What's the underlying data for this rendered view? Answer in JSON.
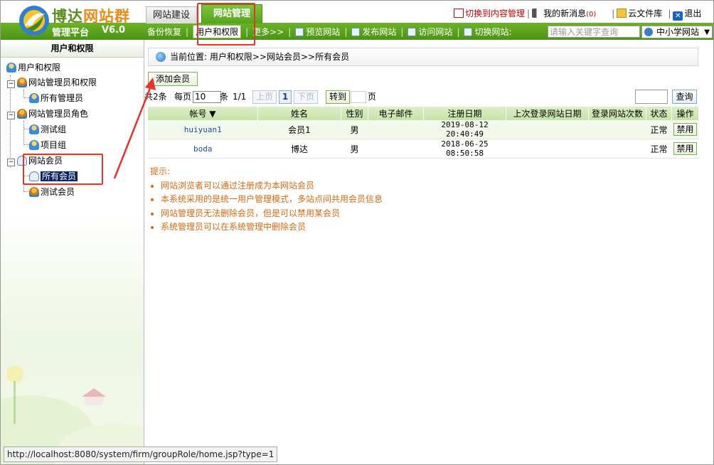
{
  "brand": {
    "name_part1": "博达",
    "name_part2": "网站群",
    "platform": "管理平台",
    "version": "V6.0"
  },
  "tabs": [
    {
      "label": "网站建设"
    },
    {
      "label": "网站管理"
    }
  ],
  "top_links": {
    "switch_content": "切换到内容管理",
    "messages": "我的新消息",
    "messages_count": "(0)",
    "cloud": "云文件库",
    "logout": "退出"
  },
  "nav": [
    {
      "label": "备份恢复"
    },
    {
      "label": "用户和权限"
    },
    {
      "label": "更多>>"
    },
    {
      "label": "预览网站"
    },
    {
      "label": "发布网站"
    },
    {
      "label": "访问网站"
    },
    {
      "label": "切换网站:"
    }
  ],
  "site_search": {
    "placeholder": "请输入关键字查询"
  },
  "site_select": {
    "value": "中小学网站"
  },
  "sidebar": {
    "title": "用户和权限",
    "tree": [
      {
        "label": "用户和权限"
      },
      {
        "label": "网站管理员和权限"
      },
      {
        "label": "所有管理员"
      },
      {
        "label": "网站管理员角色"
      },
      {
        "label": "测试组"
      },
      {
        "label": "项目组"
      },
      {
        "label": "网站会员"
      },
      {
        "label": "所有会员"
      },
      {
        "label": "测试会员"
      }
    ]
  },
  "breadcrumb": "当前位置: 用户和权限>>网站会员>>所有会员",
  "add_button": "添加会员",
  "pager": {
    "total": "共2条",
    "per_page_label": "每页",
    "per_page_value": "10",
    "unit": "条",
    "page_info": "1/1",
    "prev": "上页",
    "current": "1",
    "next": "下页",
    "goto": "转到",
    "page_suffix": "页"
  },
  "query_button": "查询",
  "table": {
    "headers": [
      "帐号 ▼",
      "姓名",
      "性别",
      "电子邮件",
      "注册日期",
      "上次登录网站日期",
      "登录网站次数",
      "状态",
      "操作"
    ],
    "rows": [
      {
        "account": "huiyuan1",
        "name": "会员1",
        "gender": "男",
        "email": "",
        "reg_date": "2019-08-12 20:40:49",
        "last_login": "",
        "login_count": "",
        "status": "正常",
        "action": "禁用"
      },
      {
        "account": "boda",
        "name": "博达",
        "gender": "男",
        "email": "",
        "reg_date": "2018-06-25 08:50:58",
        "last_login": "",
        "login_count": "",
        "status": "正常",
        "action": "禁用"
      }
    ]
  },
  "hints": {
    "title": "提示:",
    "items": [
      "网站浏览者可以通过注册成为本网站会员",
      "本系统采用的是统一用户管理模式，多站点间共用会员信息",
      "网站管理员无法删除会员，但是可以禁用某会员",
      "系统管理员可以在系统管理中删除会员"
    ]
  },
  "status_url": "http://localhost:8080/system/firm/groupRole/home.jsp?type=1",
  "colors": {
    "accent_green": "#5aa51e",
    "highlight_red": "#e8322a",
    "hint_orange": "#d46a12"
  }
}
